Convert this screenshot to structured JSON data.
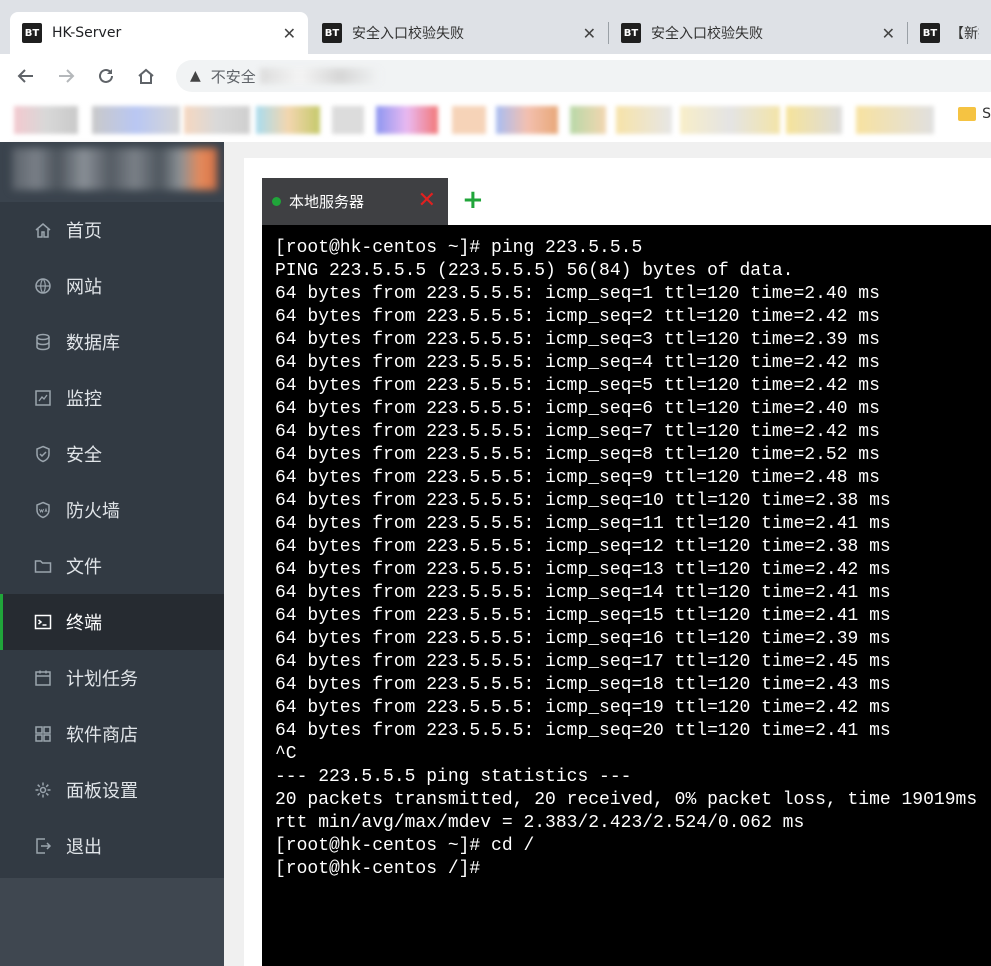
{
  "browser": {
    "tabs": [
      {
        "favicon": "BT",
        "title": "HK-Server",
        "active": true
      },
      {
        "favicon": "BT",
        "title": "安全入口校验失败",
        "active": false
      },
      {
        "favicon": "BT",
        "title": "安全入口校验失败",
        "active": false
      },
      {
        "favicon": "BT",
        "title": "【新提",
        "active": false
      }
    ],
    "close_glyph": "✕",
    "address": {
      "security_label": "不安全"
    },
    "bookmarks_end_label": "S"
  },
  "sidebar": {
    "items": [
      {
        "label": "首页",
        "icon": "home-icon"
      },
      {
        "label": "网站",
        "icon": "globe-icon"
      },
      {
        "label": "数据库",
        "icon": "database-icon"
      },
      {
        "label": "监控",
        "icon": "monitor-icon"
      },
      {
        "label": "安全",
        "icon": "shield-icon"
      },
      {
        "label": "防火墙",
        "icon": "waf-icon"
      },
      {
        "label": "文件",
        "icon": "folder-icon"
      },
      {
        "label": "终端",
        "icon": "terminal-icon",
        "active": true
      },
      {
        "label": "计划任务",
        "icon": "calendar-icon"
      },
      {
        "label": "软件商店",
        "icon": "apps-icon"
      },
      {
        "label": "面板设置",
        "icon": "gear-icon"
      },
      {
        "label": "退出",
        "icon": "logout-icon"
      }
    ],
    "accent_color": "#20a53a"
  },
  "terminal": {
    "tab_label": "本地服务器",
    "add_tab_glyph": "+",
    "close_glyph": "✕",
    "lines": [
      "[root@hk-centos ~]# ping 223.5.5.5",
      "PING 223.5.5.5 (223.5.5.5) 56(84) bytes of data.",
      "64 bytes from 223.5.5.5: icmp_seq=1 ttl=120 time=2.40 ms",
      "64 bytes from 223.5.5.5: icmp_seq=2 ttl=120 time=2.42 ms",
      "64 bytes from 223.5.5.5: icmp_seq=3 ttl=120 time=2.39 ms",
      "64 bytes from 223.5.5.5: icmp_seq=4 ttl=120 time=2.42 ms",
      "64 bytes from 223.5.5.5: icmp_seq=5 ttl=120 time=2.42 ms",
      "64 bytes from 223.5.5.5: icmp_seq=6 ttl=120 time=2.40 ms",
      "64 bytes from 223.5.5.5: icmp_seq=7 ttl=120 time=2.42 ms",
      "64 bytes from 223.5.5.5: icmp_seq=8 ttl=120 time=2.52 ms",
      "64 bytes from 223.5.5.5: icmp_seq=9 ttl=120 time=2.48 ms",
      "64 bytes from 223.5.5.5: icmp_seq=10 ttl=120 time=2.38 ms",
      "64 bytes from 223.5.5.5: icmp_seq=11 ttl=120 time=2.41 ms",
      "64 bytes from 223.5.5.5: icmp_seq=12 ttl=120 time=2.38 ms",
      "64 bytes from 223.5.5.5: icmp_seq=13 ttl=120 time=2.42 ms",
      "64 bytes from 223.5.5.5: icmp_seq=14 ttl=120 time=2.41 ms",
      "64 bytes from 223.5.5.5: icmp_seq=15 ttl=120 time=2.41 ms",
      "64 bytes from 223.5.5.5: icmp_seq=16 ttl=120 time=2.39 ms",
      "64 bytes from 223.5.5.5: icmp_seq=17 ttl=120 time=2.45 ms",
      "64 bytes from 223.5.5.5: icmp_seq=18 ttl=120 time=2.43 ms",
      "64 bytes from 223.5.5.5: icmp_seq=19 ttl=120 time=2.42 ms",
      "64 bytes from 223.5.5.5: icmp_seq=20 ttl=120 time=2.41 ms",
      "^C",
      "--- 223.5.5.5 ping statistics ---",
      "20 packets transmitted, 20 received, 0% packet loss, time 19019ms",
      "rtt min/avg/max/mdev = 2.383/2.423/2.524/0.062 ms",
      "[root@hk-centos ~]# cd /",
      "[root@hk-centos /]# "
    ]
  }
}
